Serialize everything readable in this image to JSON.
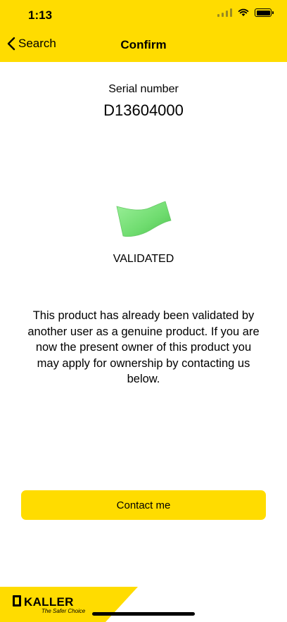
{
  "status_bar": {
    "time": "1:13"
  },
  "nav": {
    "back_label": "Search",
    "title": "Confirm"
  },
  "serial": {
    "label": "Serial number",
    "value": "D13604000"
  },
  "validation": {
    "status": "VALIDATED",
    "message": "This product has already been validated by another user as a genuine product. If you are now the present owner of this product you may apply for ownership by contacting us below."
  },
  "contact_button": {
    "label": "Contact me"
  },
  "brand": {
    "name": "KALLER",
    "tagline": "The Safer Choice"
  },
  "colors": {
    "accent": "#FFDC00",
    "flag_green": "#7CE37C"
  }
}
